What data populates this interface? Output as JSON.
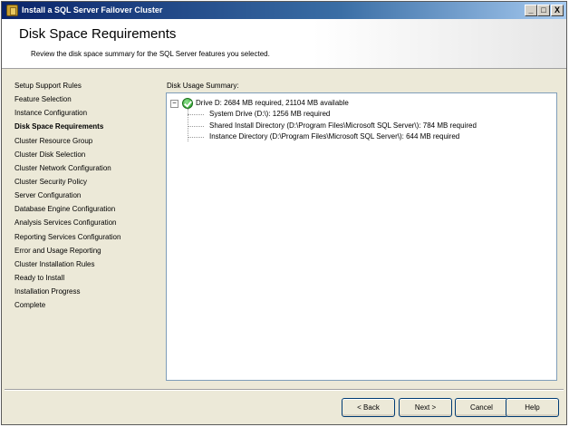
{
  "window": {
    "title": "Install a SQL Server Failover Cluster",
    "minimize": "_",
    "maximize": "□",
    "close": "X"
  },
  "header": {
    "title": "Disk Space Requirements",
    "subtitle": "Review the disk space summary for the SQL Server features you selected."
  },
  "steps": [
    "Setup Support Rules",
    "Feature Selection",
    "Instance Configuration",
    "Disk Space Requirements",
    "Cluster Resource Group",
    "Cluster Disk Selection",
    "Cluster Network Configuration",
    "Cluster Security Policy",
    "Server Configuration",
    "Database Engine Configuration",
    "Analysis Services Configuration",
    "Reporting Services Configuration",
    "Error and Usage Reporting",
    "Cluster Installation Rules",
    "Ready to Install",
    "Installation Progress",
    "Complete"
  ],
  "current_step": "Disk Space Requirements",
  "summary": {
    "label": "Disk Usage Summary:",
    "toggle": "−",
    "root": "Drive D: 2684 MB required, 21104 MB available",
    "children": [
      "System Drive (D:\\): 1256 MB required",
      "Shared Install Directory (D:\\Program Files\\Microsoft SQL Server\\): 784 MB required",
      "Instance Directory (D:\\Program Files\\Microsoft SQL Server\\): 644 MB required"
    ]
  },
  "buttons": {
    "back": "< Back",
    "next": "Next >",
    "cancel": "Cancel",
    "help": "Help"
  }
}
